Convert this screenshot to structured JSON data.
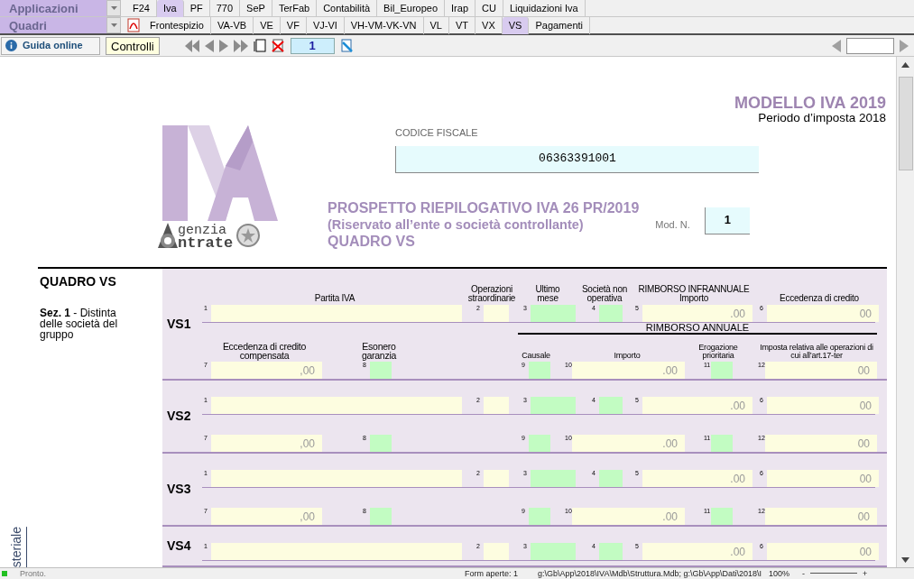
{
  "menu": {
    "label": "Applicazioni",
    "tabs": [
      {
        "label": "F24",
        "selected": false
      },
      {
        "label": "Iva",
        "selected": true
      },
      {
        "label": "PF",
        "selected": false
      },
      {
        "label": "770",
        "selected": false
      },
      {
        "label": "SeP",
        "selected": false
      },
      {
        "label": "TerFab",
        "selected": false
      },
      {
        "label": "Contabilità",
        "selected": false
      },
      {
        "label": "Bil_Europeo",
        "selected": false
      },
      {
        "label": "Irap",
        "selected": false
      },
      {
        "label": "CU",
        "selected": false
      },
      {
        "label": "Liquidazioni Iva",
        "selected": false
      }
    ]
  },
  "quadri": {
    "label": "Quadri",
    "tabs": [
      {
        "label": "Frontespizio",
        "selected": false
      },
      {
        "label": "VA-VB",
        "selected": false
      },
      {
        "label": "VE",
        "selected": false
      },
      {
        "label": "VF",
        "selected": false
      },
      {
        "label": "VJ-VI",
        "selected": false
      },
      {
        "label": "VH-VM-VK-VN",
        "selected": false
      },
      {
        "label": "VL",
        "selected": false
      },
      {
        "label": "VT",
        "selected": false
      },
      {
        "label": "VX",
        "selected": false
      },
      {
        "label": "VS",
        "selected": true
      },
      {
        "label": "Pagamenti",
        "selected": false
      }
    ]
  },
  "toolbar": {
    "guida": "Guida online",
    "controlli": "Controlli",
    "page": "1"
  },
  "header": {
    "modello": "MODELLO IVA 2019",
    "periodo": "Periodo d’imposta 2018",
    "codice_label": "CODICE FISCALE",
    "codice": "06363391001",
    "logo_lines": [
      "genzia",
      "ntrate"
    ],
    "titles": [
      "PROSPETTO RIEPILOGATIVO IVA 26 PR/2019",
      "(Riservato all’ente o società controllante)",
      "QUADRO VS"
    ],
    "mod_label": "Mod. N.",
    "mod_value": "1"
  },
  "section": {
    "title": "QUADRO VS",
    "description": "**Sez. 1** - Distinta delle società del gruppo",
    "side_text": "steriale"
  },
  "column_headings": [
    "Partita IVA",
    "Operazioni straordinarie",
    "Ultimo mese",
    "Società non operativa",
    "RIMBORSO INFRANNUALE Importo",
    "Eccedenza di credito"
  ],
  "lower_headings": [
    "Eccedenza di credito compensata",
    "Esonero garanzia"
  ],
  "rimborso_annuale": {
    "title": "RIMBORSO ANNUALE",
    "columns": [
      "Causale",
      "Importo",
      "Erogazione prioritaria",
      "Imposta relativa alle operazioni di cui all’art.17-ter"
    ]
  },
  "rows": [
    {
      "code": "VS1",
      "fields": [
        {
          "num": "1",
          "kind": "text"
        },
        {
          "num": "2",
          "kind": "text"
        },
        {
          "num": "3",
          "kind": "flag"
        },
        {
          "num": "4",
          "kind": "flag"
        },
        {
          "num": "5",
          "kind": "amount",
          "value": ".00"
        },
        {
          "num": "6",
          "kind": "amount",
          "value": "00"
        },
        {
          "num": "7",
          "kind": "amount",
          "value": ",00"
        },
        {
          "num": "8",
          "kind": "flag"
        },
        {
          "num": "9",
          "kind": "flag"
        },
        {
          "num": "10",
          "kind": "amount",
          "value": ".00"
        },
        {
          "num": "11",
          "kind": "flag"
        },
        {
          "num": "12",
          "kind": "amount",
          "value": "00"
        }
      ]
    },
    {
      "code": "VS2",
      "fields": [
        {
          "num": "1",
          "kind": "text"
        },
        {
          "num": "2",
          "kind": "text"
        },
        {
          "num": "3",
          "kind": "flag"
        },
        {
          "num": "4",
          "kind": "flag"
        },
        {
          "num": "5",
          "kind": "amount",
          "value": ".00"
        },
        {
          "num": "6",
          "kind": "amount",
          "value": "00"
        },
        {
          "num": "7",
          "kind": "amount",
          "value": ",00"
        },
        {
          "num": "8",
          "kind": "flag"
        },
        {
          "num": "9",
          "kind": "flag"
        },
        {
          "num": "10",
          "kind": "amount",
          "value": ".00"
        },
        {
          "num": "11",
          "kind": "flag"
        },
        {
          "num": "12",
          "kind": "amount",
          "value": "00"
        }
      ]
    },
    {
      "code": "VS3",
      "fields": [
        {
          "num": "1",
          "kind": "text"
        },
        {
          "num": "2",
          "kind": "text"
        },
        {
          "num": "3",
          "kind": "flag"
        },
        {
          "num": "4",
          "kind": "flag"
        },
        {
          "num": "5",
          "kind": "amount",
          "value": ".00"
        },
        {
          "num": "6",
          "kind": "amount",
          "value": "00"
        },
        {
          "num": "7",
          "kind": "amount",
          "value": ",00"
        },
        {
          "num": "8",
          "kind": "flag"
        },
        {
          "num": "9",
          "kind": "flag"
        },
        {
          "num": "10",
          "kind": "amount",
          "value": ".00"
        },
        {
          "num": "11",
          "kind": "flag"
        },
        {
          "num": "12",
          "kind": "amount",
          "value": "00"
        }
      ]
    },
    {
      "code": "VS4",
      "fields": [
        {
          "num": "1",
          "kind": "text"
        },
        {
          "num": "2",
          "kind": "text"
        },
        {
          "num": "3",
          "kind": "flag"
        },
        {
          "num": "4",
          "kind": "flag"
        },
        {
          "num": "5",
          "kind": "amount",
          "value": ".00"
        },
        {
          "num": "6",
          "kind": "amount",
          "value": "00"
        }
      ]
    }
  ],
  "status": {
    "text": "Pronto.",
    "forms": "Form aperte: 1",
    "path": "g:\\Gb\\App\\2018\\IVA\\Mdb\\Struttura.Mdb; g:\\Gb\\App\\Dati\\2018\\I",
    "zoom": "100%",
    "minus": "-",
    "plus": "+"
  }
}
